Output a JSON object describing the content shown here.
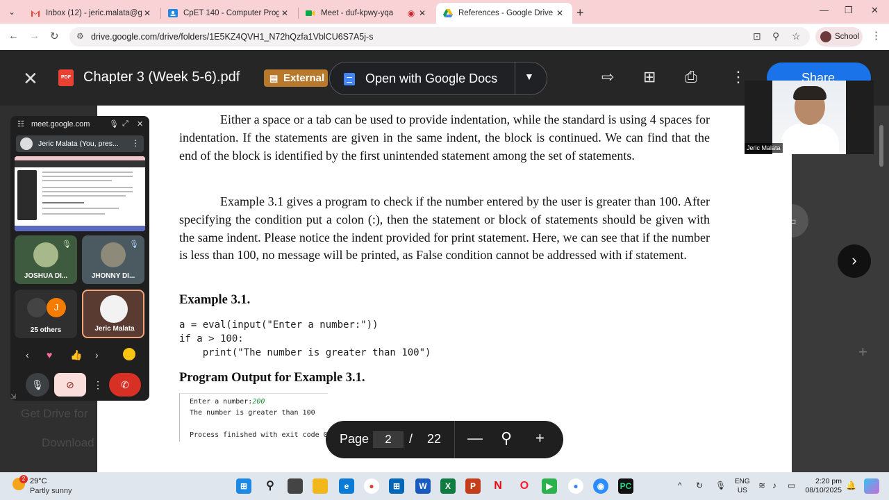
{
  "browser": {
    "tabs": [
      {
        "title": "Inbox (12) - jeric.malata@g.bat",
        "favicon": "gmail-icon",
        "active": false
      },
      {
        "title": "CpET 140 - Computer Programm",
        "favicon": "classroom-icon",
        "active": false
      },
      {
        "title": "Meet - duf-kpwy-yqa",
        "favicon": "meet-icon",
        "active": false
      },
      {
        "title": "References - Google Drive",
        "favicon": "drive-icon",
        "active": true
      }
    ],
    "url": "drive.google.com/drive/folders/1E5KZ4QVH1_N72hQzfa1VblCU6S7A5j-s",
    "profile_label": "School"
  },
  "viewer": {
    "file_title": "Chapter 3 (Week 5-6).pdf",
    "pdf_badge": "PDF",
    "external_label": "External",
    "open_with_label": "Open with Google Docs",
    "share_label": "Share"
  },
  "document": {
    "para1": "Either a space or a tab can be used to provide indentation, while the standard is using 4 spaces for indentation. If the statements are given in the same indent, the block is continued. We can find that the end of the block is identified by the first unintended statement among the set of statements.",
    "para2": "Example 3.1 gives a program to check if the number entered by the user is greater than 100. After specifying the condition put a colon (:), then the statement or block of statements should be given with the same indent. Please notice the indent provided for print statement. Here, we can see that if the number is less than 100, no message will be printed, as False condition cannot be addressed with if statement.",
    "example_heading": "Example 3.1.",
    "code_lines": [
      "a = eval(input(\"Enter a number:\"))",
      "if a > 100:",
      "    print(\"The number is greater than 100\")"
    ],
    "output_heading": "Program Output for Example 3.1.",
    "console": {
      "prompt": "Enter a number:",
      "input_value": "200",
      "line2": "The number is greater than 100",
      "line3": "Process finished with exit code 0"
    }
  },
  "pager": {
    "label": "Page",
    "current": "2",
    "separator": "/",
    "total": "22"
  },
  "meet": {
    "url": "meet.google.com",
    "presenting_label": "Jeric Malata (You, pres...",
    "participants": [
      {
        "name": "JOSHUA DI...",
        "muted": true
      },
      {
        "name": "JHONNY DI...",
        "muted": true
      },
      {
        "name": "25 others",
        "initial": "J"
      },
      {
        "name": "Jeric Malata",
        "self": true
      }
    ],
    "speaker_name": "Jeric Malata"
  },
  "left_panel_faded": {
    "line1": "Get Drive for",
    "line2": "Download"
  },
  "taskbar": {
    "temperature": "29°C",
    "condition": "Partly sunny",
    "weather_badge": "2",
    "lang_line1": "ENG",
    "lang_line2": "US",
    "time": "2:20 pm",
    "date": "08/10/2025"
  },
  "colors": {
    "tabstrip_bg": "#f9d2d6",
    "viewer_bg": "#262626",
    "external_badge": "#b9792c",
    "share_blue": "#1a73e8",
    "end_call_red": "#d93025"
  }
}
